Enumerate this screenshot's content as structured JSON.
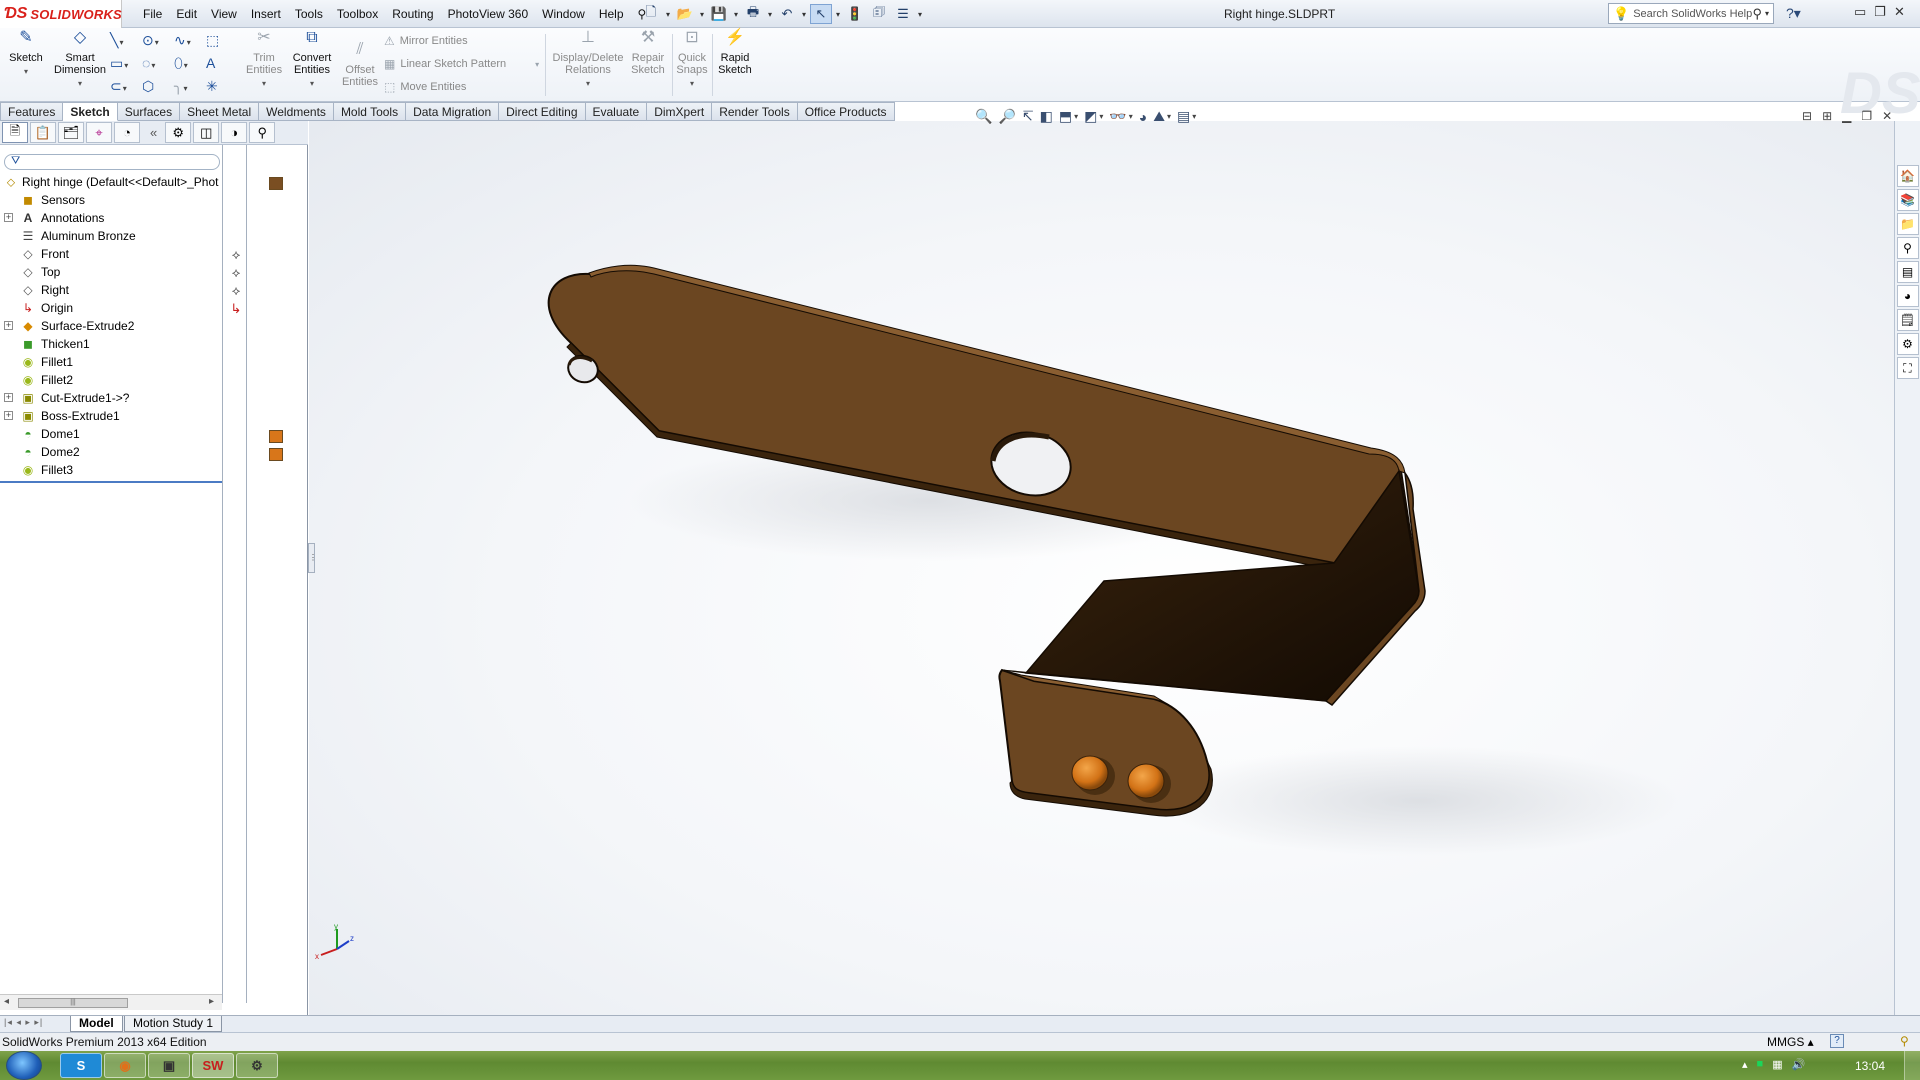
{
  "app": {
    "logo": "SOLIDWORKS",
    "window_title": "Right hinge.SLDPRT",
    "menus": [
      "File",
      "Edit",
      "View",
      "Insert",
      "Tools",
      "Toolbox",
      "Routing",
      "PhotoView 360",
      "Window",
      "Help"
    ],
    "search_placeholder": "Search SolidWorks Help"
  },
  "ribbon": {
    "sketch": "Sketch",
    "smart_dimension_1": "Smart",
    "smart_dimension_2": "Dimension",
    "trim_1": "Trim",
    "trim_2": "Entities",
    "convert_1": "Convert",
    "convert_2": "Entities",
    "offset_1": "Offset",
    "offset_2": "Entities",
    "mirror": "Mirror Entities",
    "linear_pattern": "Linear Sketch Pattern",
    "move": "Move Entities",
    "display_delete_1": "Display/Delete",
    "display_delete_2": "Relations",
    "repair_1": "Repair",
    "repair_2": "Sketch",
    "quick_snaps_1": "Quick",
    "quick_snaps_2": "Snaps",
    "rapid_1": "Rapid",
    "rapid_2": "Sketch"
  },
  "tabs": [
    "Features",
    "Sketch",
    "Surfaces",
    "Sheet Metal",
    "Weldments",
    "Mold Tools",
    "Data Migration",
    "Direct Editing",
    "Evaluate",
    "DimXpert",
    "Render Tools",
    "Office Products"
  ],
  "active_tab": "Sketch",
  "tree": {
    "root": "Right hinge  (Default<<Default>_Phot",
    "items": [
      {
        "label": "Sensors",
        "icon": "sensors-icon",
        "expandable": false
      },
      {
        "label": "Annotations",
        "icon": "annotations-icon",
        "expandable": true
      },
      {
        "label": "Aluminum Bronze",
        "icon": "material-icon",
        "expandable": false
      },
      {
        "label": "Front",
        "icon": "plane-icon",
        "expandable": false
      },
      {
        "label": "Top",
        "icon": "plane-icon",
        "expandable": false
      },
      {
        "label": "Right",
        "icon": "plane-icon",
        "expandable": false
      },
      {
        "label": "Origin",
        "icon": "origin-icon",
        "expandable": false
      },
      {
        "label": "Surface-Extrude2",
        "icon": "surface-extrude-icon",
        "expandable": true
      },
      {
        "label": "Thicken1",
        "icon": "thicken-icon",
        "expandable": false
      },
      {
        "label": "Fillet1",
        "icon": "fillet-icon",
        "expandable": false
      },
      {
        "label": "Fillet2",
        "icon": "fillet-icon",
        "expandable": false
      },
      {
        "label": "Cut-Extrude1->?",
        "icon": "cut-extrude-icon",
        "expandable": true
      },
      {
        "label": "Boss-Extrude1",
        "icon": "boss-extrude-icon",
        "expandable": true
      },
      {
        "label": "Dome1",
        "icon": "dome-icon",
        "expandable": false
      },
      {
        "label": "Dome2",
        "icon": "dome-icon",
        "expandable": false
      },
      {
        "label": "Fillet3",
        "icon": "fillet-icon",
        "expandable": false
      }
    ]
  },
  "colors": {
    "part_face": "#6e4a22",
    "part_edge": "#1a0f05",
    "part_inner": "#2a1a0a",
    "dome": "#d87a1c",
    "selection_blue": "#4b7bc4"
  },
  "bottom_tabs": [
    "Model",
    "Motion Study 1"
  ],
  "status": {
    "text": "SolidWorks Premium 2013 x64 Edition",
    "units": "MMGS",
    "help": "?"
  },
  "taskbar": {
    "apps": [
      "S",
      "firefox",
      "explorer",
      "solidworks",
      "other"
    ],
    "clock": "13:04"
  }
}
